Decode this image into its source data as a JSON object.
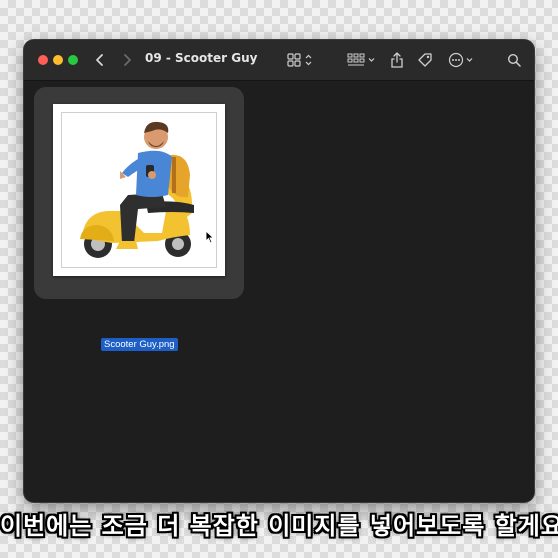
{
  "window": {
    "title": "09 - Scooter Guy",
    "toolbar_icons": [
      "back-chevron-icon",
      "forward-chevron-icon",
      "icon-view-icon",
      "group-by-icon",
      "share-icon",
      "tag-icon",
      "more-actions-icon",
      "search-icon"
    ]
  },
  "files": [
    {
      "name": "Scooter Guy.png",
      "selected": true
    }
  ],
  "caption": "이번에는 조금 더 복잡한 이미지를 넣어보도록 할게요.",
  "colors": {
    "selection": "#1d5fc7",
    "scooter": "#f2c230",
    "shirt": "#4a86d6"
  }
}
